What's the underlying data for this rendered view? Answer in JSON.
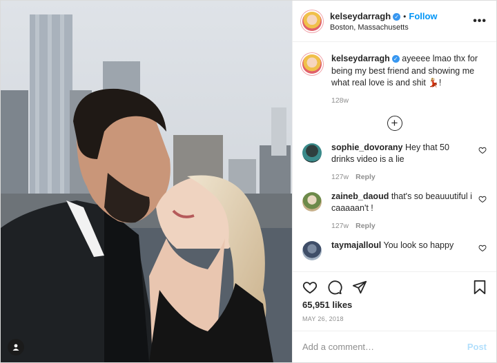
{
  "post": {
    "username": "kelseydarragh",
    "follow_label": "Follow",
    "separator": "•",
    "location": "Boston, Massachusetts",
    "more_label": "•••",
    "caption": {
      "username": "kelseydarragh",
      "text": "ayeeee lmao thx for being my best friend and showing me what real love is and shit 💃🏼!",
      "age": "128w"
    },
    "expand_label": "+",
    "comments": [
      {
        "username": "sophie_dovorany",
        "text": "Hey that 50 drinks video is a lie",
        "age": "127w",
        "reply": "Reply"
      },
      {
        "username": "zaineb_daoud",
        "text": "that's so beauuutiful i caaaaan't !",
        "age": "127w",
        "reply": "Reply"
      },
      {
        "username": "taymajalloul",
        "text": "You look so happy",
        "age": "",
        "reply": ""
      }
    ],
    "likes": "65,951 likes",
    "date": "MAY 26, 2018",
    "add_comment_placeholder": "Add a comment…",
    "post_label": "Post"
  },
  "colors": {
    "accent": "#0095f6",
    "verified": "#3897f0",
    "post_disabled": "#b2dffc",
    "muted": "#8e8e8e"
  },
  "icons": [
    "user-tag-icon",
    "verified-icon",
    "more-icon",
    "add-circle-icon",
    "heart-icon",
    "comment-icon",
    "share-icon",
    "bookmark-icon"
  ]
}
